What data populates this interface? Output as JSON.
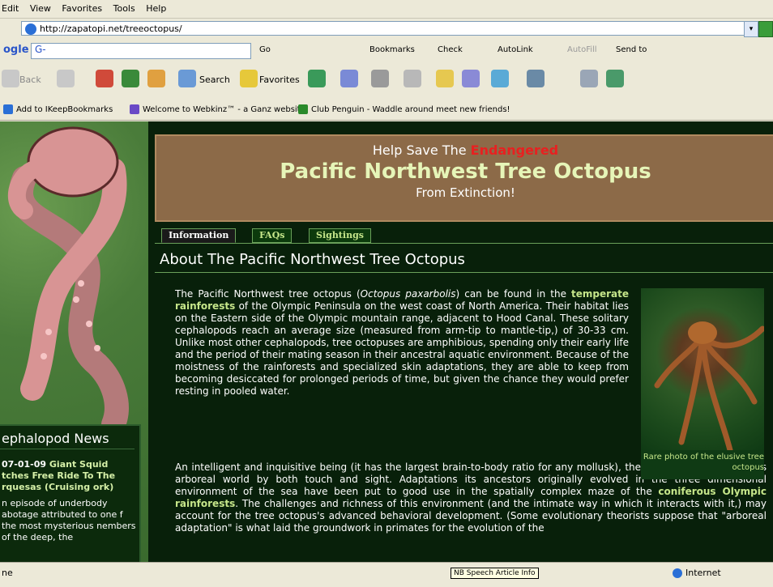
{
  "menu": [
    "Edit",
    "View",
    "Favorites",
    "Tools",
    "Help"
  ],
  "address": {
    "url": "http://zapatopi.net/treeoctopus/",
    "drop_glyph": "▾"
  },
  "google_bar": {
    "logo": "ogle",
    "field_logo": "G-",
    "items": [
      "Go",
      "Bookmarks",
      "Check",
      "AutoLink",
      "AutoFill",
      "Send to"
    ]
  },
  "toolbar": {
    "back": "Back",
    "search": "Search",
    "favorites": "Favorites"
  },
  "links": [
    "Add to IKeepBookmarks",
    "Welcome to Webkinz™ - a Ganz website",
    "Club Penguin - Waddle around meet new friends!"
  ],
  "banner": {
    "line1_pre": "Help Save The",
    "line1_red": "Endangered",
    "title": "Pacific Northwest Tree Octopus",
    "line3": "From Extinction!"
  },
  "tabs": [
    "Information",
    "FAQs",
    "Sightings"
  ],
  "heading": "About The Pacific Northwest Tree Octopus",
  "para1": {
    "a": "The Pacific Northwest tree octopus (",
    "latin": "Octopus paxarbolis",
    "b": ") can be found in the",
    "bold": "temperate rainforests",
    "c": "of the Olympic Peninsula on the west coast of North America. Their habitat lies on the Eastern side of the Olympic mountain range, adjacent to Hood Canal. These solitary cephalopods reach an average size (measured from arm-tip to mantle-tip,) of 30-33 cm. Unlike most other cephalopods, tree octopuses are amphibious, spending only their early life and the period of their mating season in their ancestral aquatic environment. Because of the moistness of the rainforests and specialized skin adaptations, they are able to keep from becoming desiccated for prolonged periods of time, but given the chance they would prefer resting in pooled water."
  },
  "para2": {
    "a": "An intelligent and inquisitive being (it has the largest brain-to-body ratio for any mollusk), the tree octopus explores its arboreal world by both touch and sight. Adaptations its ancestors originally evolved in the three dimensional environment of the sea have been put to good use in the spatially complex maze of the",
    "bold": "coniferous Olympic rainforests",
    "b": ". The challenges and richness of this environment (and the intimate way in which it interacts with it,) may account for the tree octopus's advanced behavioral development. (Some evolutionary theorists suppose that \"arboreal adaptation\" is what laid the groundwork in primates for the evolution of the"
  },
  "photo_caption": "Rare photo of the elusive tree octopus",
  "news": {
    "title": "ephalopod News",
    "date": "07-01-09",
    "headline": "Giant Squid tches Free Ride To The rquesas (Cruising ork)",
    "body": "n episode of underbody abotage attributed to one f the most mysterious nembers of the deep, the"
  },
  "status": {
    "left": "ne",
    "tooltip": "NB Speech Article Info",
    "zone": "Internet"
  }
}
